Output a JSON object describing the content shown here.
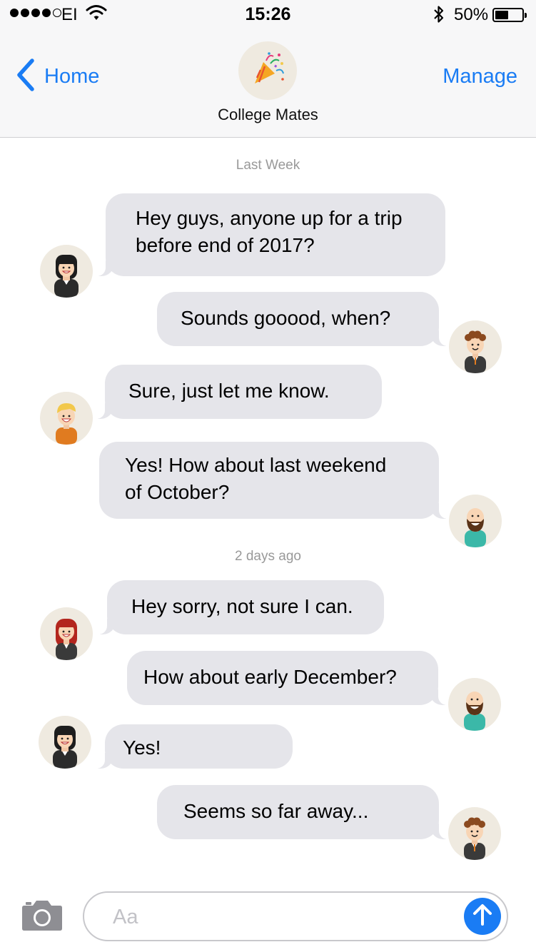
{
  "status_bar": {
    "carrier": "EI",
    "time": "15:26",
    "battery_percent": "50%",
    "battery_level": 0.5,
    "signal_bars_filled": 4,
    "signal_bars_total": 5,
    "icons": [
      "wifi-icon",
      "bluetooth-icon",
      "battery-icon"
    ]
  },
  "nav": {
    "back_label": "Home",
    "manage_label": "Manage",
    "group_name": "College Mates",
    "group_icon": "party-popper-icon"
  },
  "conversation": {
    "timestamps": [
      "Last Week",
      "2 days ago"
    ],
    "messages": [
      {
        "sender": "black-hair-woman",
        "side": "left",
        "text_lines": [
          "Hey guys, anyone up for a trip",
          "before end of 2017?"
        ]
      },
      {
        "sender": "brown-curly-man",
        "side": "right",
        "text_lines": [
          "Sounds gooood, when?"
        ]
      },
      {
        "sender": "blonde-man",
        "side": "left",
        "text_lines": [
          "Sure, just let me know."
        ]
      },
      {
        "sender": "bearded-man",
        "side": "right",
        "text_lines": [
          "Yes! How about last weekend",
          "of October?"
        ]
      },
      {
        "sender": "red-hair-woman",
        "side": "left",
        "text_lines": [
          "Hey sorry, not sure I can."
        ]
      },
      {
        "sender": "bearded-man",
        "side": "right",
        "text_lines": [
          "How about early December?"
        ]
      },
      {
        "sender": "black-hair-woman",
        "side": "left",
        "text_lines": [
          "Yes!"
        ]
      },
      {
        "sender": "brown-curly-man",
        "side": "right",
        "text_lines": [
          "Seems so far away..."
        ]
      }
    ]
  },
  "composer": {
    "placeholder": "Aa",
    "value": "",
    "camera_icon": "camera-icon",
    "send_icon": "arrow-up-icon"
  },
  "colors": {
    "accent": "#1a7cf4",
    "bubble": "#e5e5ea",
    "timestamp": "#999999",
    "avatar_bg": "#efeae0"
  }
}
